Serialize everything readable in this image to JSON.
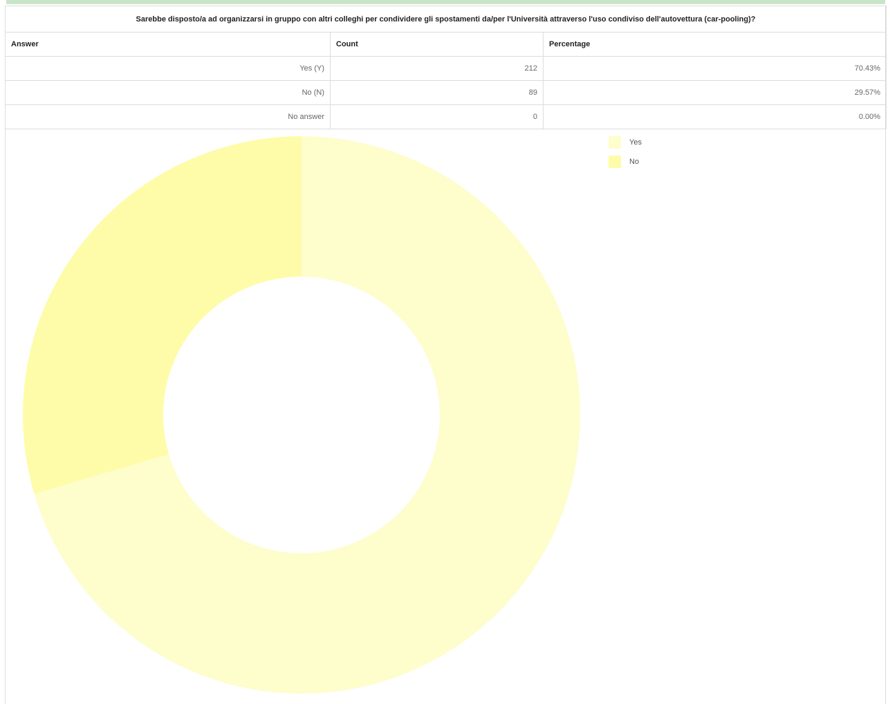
{
  "question": "Sarebbe disposto/a ad organizzarsi in gruppo con altri colleghi per condividere gli spostamenti da/per l'Università attraverso l'uso condiviso dell'autovettura (car-pooling)?",
  "table": {
    "headers": [
      "Answer",
      "Count",
      "Percentage"
    ],
    "rows": [
      {
        "answer": "Yes (Y)",
        "count": "212",
        "percentage": "70.43%"
      },
      {
        "answer": "No (N)",
        "count": "89",
        "percentage": "29.57%"
      },
      {
        "answer": "No answer",
        "count": "0",
        "percentage": "0.00%"
      }
    ]
  },
  "colors": {
    "yes": "#fefdcc",
    "no": "#fefca8",
    "header_bar": "#c9e5c7"
  },
  "chart_data": {
    "type": "pie",
    "variant": "donut",
    "title": "",
    "categories": [
      "Yes",
      "No"
    ],
    "values": [
      212,
      89
    ],
    "percentages": [
      70.43,
      29.57
    ],
    "colors": [
      "#fefdcc",
      "#fefca8"
    ],
    "legend": {
      "position": "top-right",
      "entries": [
        "Yes",
        "No"
      ]
    },
    "start_angle_deg": 0,
    "direction": "clockwise"
  }
}
